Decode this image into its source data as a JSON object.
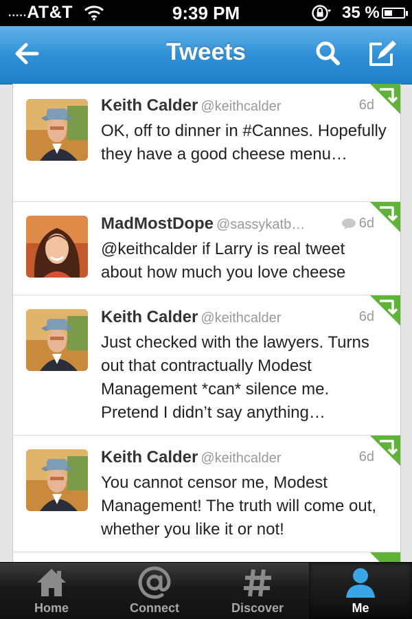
{
  "status_bar": {
    "carrier": "AT&T",
    "signal_dots": ".....",
    "time": "9:39 PM",
    "battery_percent": "35 %",
    "battery_level": 0.35
  },
  "nav": {
    "title": "Tweets"
  },
  "tweets": [
    {
      "name": "Keith Calder",
      "handle": "@keithcalder",
      "time": "6d",
      "text": "OK, off to dinner in #Cannes. Hopefully they have a good cheese menu…",
      "has_reply_icon": false
    },
    {
      "name": "MadMostDope",
      "handle": "@sassykatb…",
      "time": "6d",
      "text": "@keithcalder if Larry is real tweet about how much you love cheese",
      "has_reply_icon": true
    },
    {
      "name": "Keith Calder",
      "handle": "@keithcalder",
      "time": "6d",
      "text": "Just checked with the lawyers. Turns out that contractually Modest Management *can* silence me. Pretend I didn’t say anything…",
      "has_reply_icon": false
    },
    {
      "name": "Keith Calder",
      "handle": "@keithcalder",
      "time": "6d",
      "text": "You cannot censor me, Modest Management! The truth will come out, whether you like it or not!",
      "has_reply_icon": false
    }
  ],
  "tabs": [
    {
      "label": "Home",
      "icon": "home-icon",
      "active": false
    },
    {
      "label": "Connect",
      "icon": "at-icon",
      "active": false
    },
    {
      "label": "Discover",
      "icon": "hashtag-icon",
      "active": false
    },
    {
      "label": "Me",
      "icon": "person-icon",
      "active": true
    }
  ],
  "colors": {
    "nav_blue": "#2e8fd6",
    "retweet_green": "#5fb336",
    "active_tab_icon": "#3aa6e8"
  }
}
